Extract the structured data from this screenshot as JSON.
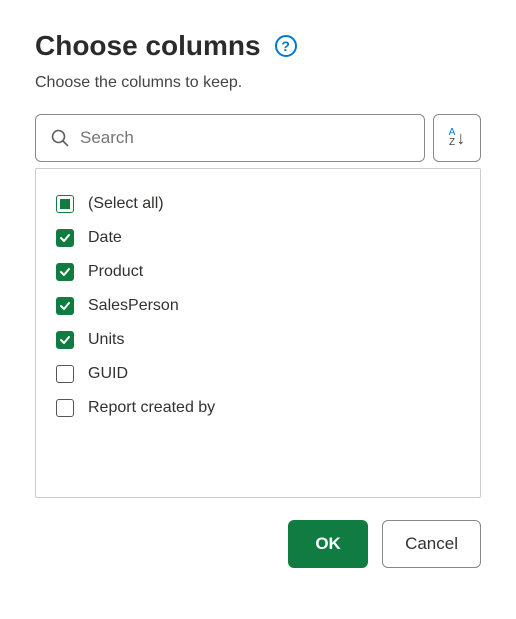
{
  "dialog": {
    "title": "Choose columns",
    "subtitle": "Choose the columns to keep.",
    "help_tooltip": "?"
  },
  "search": {
    "placeholder": "Search",
    "value": ""
  },
  "sort": {
    "a": "A",
    "z": "Z"
  },
  "columns": {
    "select_all": {
      "label": "(Select all)",
      "state": "indeterminate"
    },
    "items": [
      {
        "label": "Date",
        "checked": true
      },
      {
        "label": "Product",
        "checked": true
      },
      {
        "label": "SalesPerson",
        "checked": true
      },
      {
        "label": "Units",
        "checked": true
      },
      {
        "label": "GUID",
        "checked": false
      },
      {
        "label": "Report created by",
        "checked": false
      }
    ]
  },
  "buttons": {
    "ok": "OK",
    "cancel": "Cancel"
  },
  "colors": {
    "accent": "#107c41",
    "link": "#0078d4"
  }
}
